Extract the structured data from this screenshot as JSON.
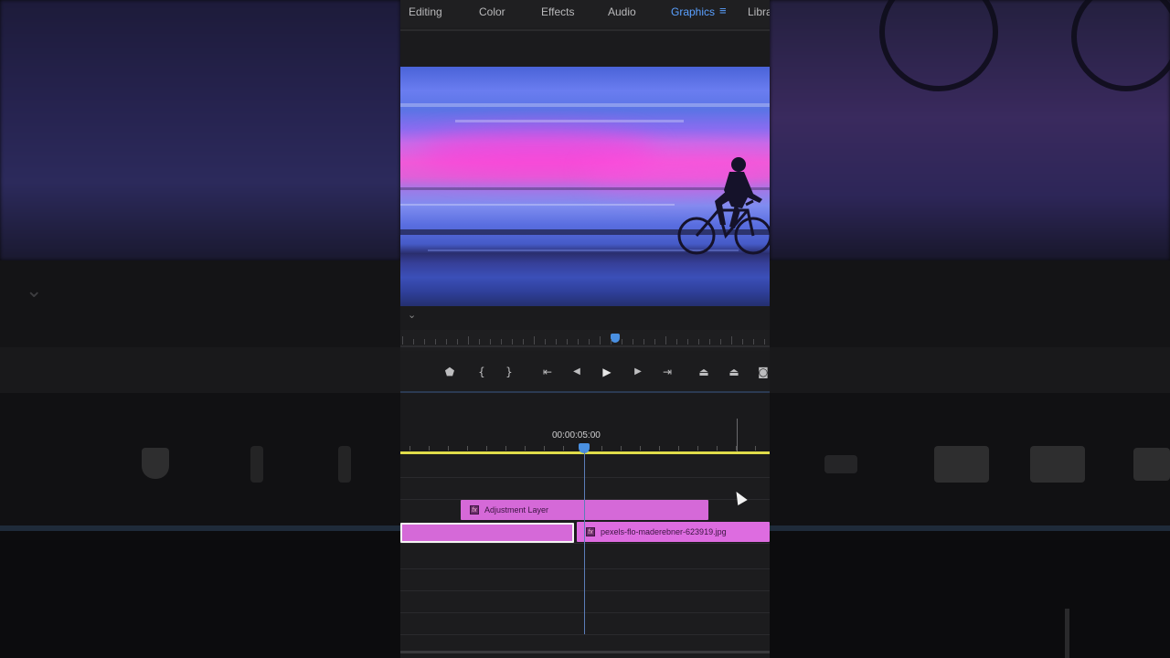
{
  "workspaces": {
    "tabs": [
      {
        "label": "Editing"
      },
      {
        "label": "Color"
      },
      {
        "label": "Effects"
      },
      {
        "label": "Audio"
      },
      {
        "label": "Graphics"
      },
      {
        "label": "Libra"
      }
    ],
    "active_index": 4,
    "menu_icon": "hamburger-icon"
  },
  "program_monitor": {
    "dropdown_icon": "chevron-down-icon"
  },
  "transport": {
    "buttons": [
      {
        "name": "add-marker-button",
        "glyph": "⬟"
      },
      {
        "name": "mark-in-button",
        "glyph": "{"
      },
      {
        "name": "mark-out-button",
        "glyph": "}"
      },
      {
        "name": "go-to-in-button",
        "glyph": "⇤"
      },
      {
        "name": "step-back-button",
        "glyph": "◀"
      },
      {
        "name": "play-button",
        "glyph": "▶"
      },
      {
        "name": "step-forward-button",
        "glyph": "▶"
      },
      {
        "name": "go-to-out-button",
        "glyph": "⇥"
      },
      {
        "name": "lift-button",
        "glyph": "⏏"
      },
      {
        "name": "extract-button",
        "glyph": "⏏"
      },
      {
        "name": "export-frame-button",
        "glyph": "◙"
      }
    ]
  },
  "timeline": {
    "timecode": "00:00:05:00",
    "clips": {
      "adjustment": {
        "label": "Adjustment Layer",
        "fx": "fx"
      },
      "image": {
        "label": "pexels-flo-maderebner-623919.jpg",
        "fx": "fx"
      }
    }
  },
  "colors": {
    "accent": "#5aa0ff",
    "clip": "#d569d8",
    "work_area": "#e0dc4a",
    "playhead": "#4a90e2"
  }
}
